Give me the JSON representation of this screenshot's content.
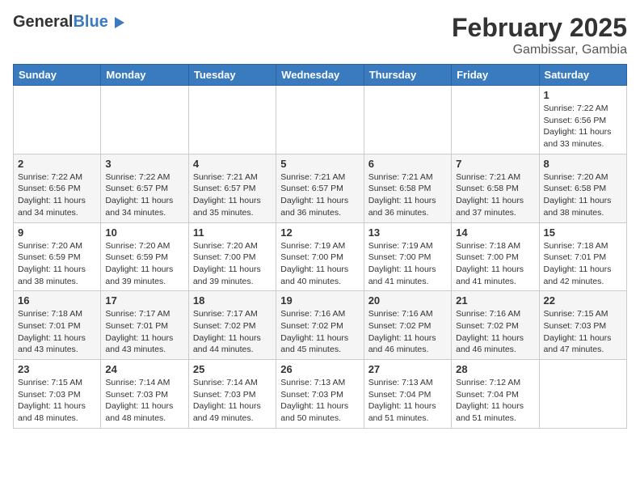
{
  "header": {
    "logo_general": "General",
    "logo_blue": "Blue",
    "title": "February 2025",
    "subtitle": "Gambissar, Gambia"
  },
  "columns": [
    "Sunday",
    "Monday",
    "Tuesday",
    "Wednesday",
    "Thursday",
    "Friday",
    "Saturday"
  ],
  "weeks": [
    {
      "row": 1,
      "days": [
        {
          "num": "",
          "info": ""
        },
        {
          "num": "",
          "info": ""
        },
        {
          "num": "",
          "info": ""
        },
        {
          "num": "",
          "info": ""
        },
        {
          "num": "",
          "info": ""
        },
        {
          "num": "",
          "info": ""
        },
        {
          "num": "1",
          "info": "Sunrise: 7:22 AM\nSunset: 6:56 PM\nDaylight: 11 hours and 33 minutes."
        }
      ]
    },
    {
      "row": 2,
      "days": [
        {
          "num": "2",
          "info": "Sunrise: 7:22 AM\nSunset: 6:56 PM\nDaylight: 11 hours and 34 minutes."
        },
        {
          "num": "3",
          "info": "Sunrise: 7:22 AM\nSunset: 6:57 PM\nDaylight: 11 hours and 34 minutes."
        },
        {
          "num": "4",
          "info": "Sunrise: 7:21 AM\nSunset: 6:57 PM\nDaylight: 11 hours and 35 minutes."
        },
        {
          "num": "5",
          "info": "Sunrise: 7:21 AM\nSunset: 6:57 PM\nDaylight: 11 hours and 36 minutes."
        },
        {
          "num": "6",
          "info": "Sunrise: 7:21 AM\nSunset: 6:58 PM\nDaylight: 11 hours and 36 minutes."
        },
        {
          "num": "7",
          "info": "Sunrise: 7:21 AM\nSunset: 6:58 PM\nDaylight: 11 hours and 37 minutes."
        },
        {
          "num": "8",
          "info": "Sunrise: 7:20 AM\nSunset: 6:58 PM\nDaylight: 11 hours and 38 minutes."
        }
      ]
    },
    {
      "row": 3,
      "days": [
        {
          "num": "9",
          "info": "Sunrise: 7:20 AM\nSunset: 6:59 PM\nDaylight: 11 hours and 38 minutes."
        },
        {
          "num": "10",
          "info": "Sunrise: 7:20 AM\nSunset: 6:59 PM\nDaylight: 11 hours and 39 minutes."
        },
        {
          "num": "11",
          "info": "Sunrise: 7:20 AM\nSunset: 7:00 PM\nDaylight: 11 hours and 39 minutes."
        },
        {
          "num": "12",
          "info": "Sunrise: 7:19 AM\nSunset: 7:00 PM\nDaylight: 11 hours and 40 minutes."
        },
        {
          "num": "13",
          "info": "Sunrise: 7:19 AM\nSunset: 7:00 PM\nDaylight: 11 hours and 41 minutes."
        },
        {
          "num": "14",
          "info": "Sunrise: 7:18 AM\nSunset: 7:00 PM\nDaylight: 11 hours and 41 minutes."
        },
        {
          "num": "15",
          "info": "Sunrise: 7:18 AM\nSunset: 7:01 PM\nDaylight: 11 hours and 42 minutes."
        }
      ]
    },
    {
      "row": 4,
      "days": [
        {
          "num": "16",
          "info": "Sunrise: 7:18 AM\nSunset: 7:01 PM\nDaylight: 11 hours and 43 minutes."
        },
        {
          "num": "17",
          "info": "Sunrise: 7:17 AM\nSunset: 7:01 PM\nDaylight: 11 hours and 43 minutes."
        },
        {
          "num": "18",
          "info": "Sunrise: 7:17 AM\nSunset: 7:02 PM\nDaylight: 11 hours and 44 minutes."
        },
        {
          "num": "19",
          "info": "Sunrise: 7:16 AM\nSunset: 7:02 PM\nDaylight: 11 hours and 45 minutes."
        },
        {
          "num": "20",
          "info": "Sunrise: 7:16 AM\nSunset: 7:02 PM\nDaylight: 11 hours and 46 minutes."
        },
        {
          "num": "21",
          "info": "Sunrise: 7:16 AM\nSunset: 7:02 PM\nDaylight: 11 hours and 46 minutes."
        },
        {
          "num": "22",
          "info": "Sunrise: 7:15 AM\nSunset: 7:03 PM\nDaylight: 11 hours and 47 minutes."
        }
      ]
    },
    {
      "row": 5,
      "days": [
        {
          "num": "23",
          "info": "Sunrise: 7:15 AM\nSunset: 7:03 PM\nDaylight: 11 hours and 48 minutes."
        },
        {
          "num": "24",
          "info": "Sunrise: 7:14 AM\nSunset: 7:03 PM\nDaylight: 11 hours and 48 minutes."
        },
        {
          "num": "25",
          "info": "Sunrise: 7:14 AM\nSunset: 7:03 PM\nDaylight: 11 hours and 49 minutes."
        },
        {
          "num": "26",
          "info": "Sunrise: 7:13 AM\nSunset: 7:03 PM\nDaylight: 11 hours and 50 minutes."
        },
        {
          "num": "27",
          "info": "Sunrise: 7:13 AM\nSunset: 7:04 PM\nDaylight: 11 hours and 51 minutes."
        },
        {
          "num": "28",
          "info": "Sunrise: 7:12 AM\nSunset: 7:04 PM\nDaylight: 11 hours and 51 minutes."
        },
        {
          "num": "",
          "info": ""
        }
      ]
    }
  ]
}
